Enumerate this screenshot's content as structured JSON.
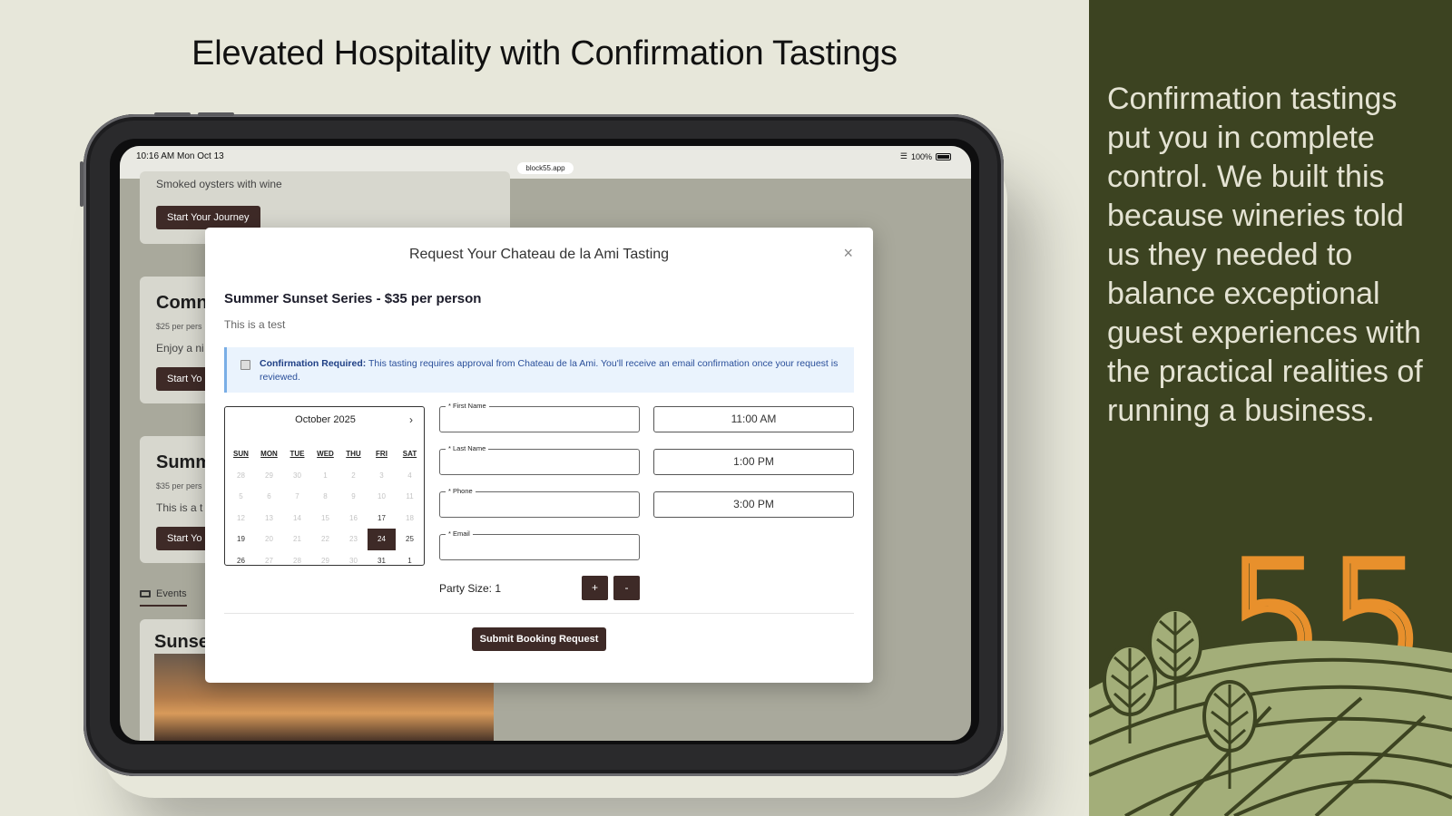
{
  "title": "Elevated Hospitality with Confirmation Tastings",
  "statusbar": {
    "time": "10:16 AM  Mon Oct 13",
    "battery": "100%",
    "url": "block55.app"
  },
  "background_cards": [
    {
      "title": "",
      "price": "",
      "desc": "Smoked oysters with wine",
      "button": "Start Your Journey"
    },
    {
      "title": "Comn",
      "price": "$25 per pers",
      "desc": "Enjoy a ni",
      "button": "Start Yo"
    },
    {
      "title": "Summ",
      "price": "$35 per pers",
      "desc": "This is a t",
      "button": "Start Yo"
    }
  ],
  "events_tab": "Events",
  "sunset_title": "Sunse",
  "modal": {
    "title": "Request Your Chateau de la Ami Tasting",
    "close": "×",
    "series_title": "Summer Sunset Series - $35 per person",
    "series_desc": "This is a test",
    "notice_bold": "Confirmation Required:",
    "notice_text": " This tasting requires approval from Chateau de la Ami. You'll receive an email confirmation once your request is reviewed.",
    "calendar": {
      "month": "October 2025",
      "next": "›",
      "weekdays": [
        "SUN",
        "MON",
        "TUE",
        "WED",
        "THU",
        "FRI",
        "SAT"
      ],
      "days": [
        "28",
        "29",
        "30",
        "1",
        "2",
        "3",
        "4",
        "5",
        "6",
        "7",
        "8",
        "9",
        "10",
        "11",
        "12",
        "13",
        "14",
        "15",
        "16",
        "17",
        "18",
        "19",
        "20",
        "21",
        "22",
        "23",
        "24",
        "25",
        "26",
        "27",
        "28",
        "29",
        "30",
        "31",
        "1"
      ],
      "available": [
        "17",
        "19",
        "24",
        "25",
        "26",
        "31",
        "1"
      ],
      "selected": "24"
    },
    "fields": {
      "first_name": "* First Name",
      "last_name": "* Last Name",
      "phone": "* Phone",
      "email": "* Email"
    },
    "times": [
      "11:00  AM",
      "1:00  PM",
      "3:00  PM"
    ],
    "party_size": "Party Size: 1",
    "plus": "+",
    "minus": "-",
    "submit": "Submit Booking Request"
  },
  "panel": {
    "text": "Confirmation tastings put you in complete control. We built this because wineries told us they needed to balance exceptional guest experiences with the practical realities of running a business.",
    "logo_number": "55"
  },
  "colors": {
    "panel_bg": "#3c4321",
    "accent_orange": "#e8902c",
    "button_brown": "#3e2a27",
    "hills": "#a3ae79"
  }
}
